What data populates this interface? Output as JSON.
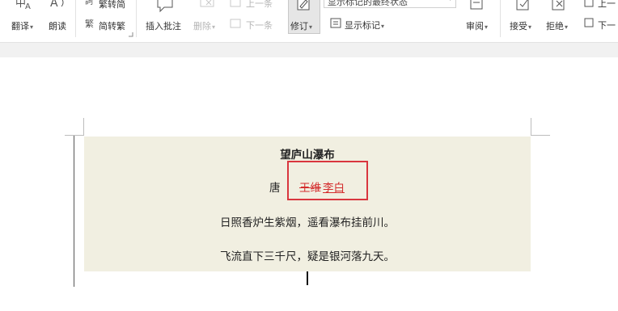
{
  "ribbon": {
    "translate_label": "翻译",
    "read_aloud_label": "朗读",
    "trad_simp_label": "繁转简",
    "simp_trad_label": "简转繁",
    "insert_comment_label": "插入批注",
    "delete_label": "删除",
    "prev_label": "上一条",
    "next_label": "下一条",
    "track_changes_label": "修订",
    "display_mode_value": "显示标记的最终状态",
    "show_markup_label": "显示标记",
    "review_label": "审阅",
    "accept_label": "接受",
    "reject_label": "拒绝",
    "prev_change_label": "上一",
    "next_change_label": "下一"
  },
  "document": {
    "title": "望庐山瀑布",
    "dynasty": "唐",
    "deleted_author": "王维",
    "inserted_author": "李白",
    "verse1": "日照香炉生紫烟，遥看瀑布挂前川。",
    "verse2": "飞流直下三千尺，疑是银河落九天。"
  },
  "colors": {
    "revision": "#d42d2d",
    "highlight_box": "#d9363e",
    "page_shading": "#f1efe1"
  }
}
